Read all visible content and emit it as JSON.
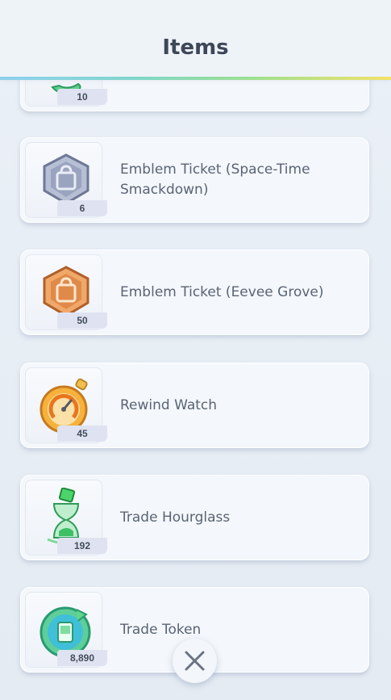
{
  "header": {
    "title": "Items"
  },
  "items": [
    {
      "name": "",
      "qty": "10",
      "icon": "green-item-icon"
    },
    {
      "name": "Emblem Ticket (Space-Time Smackdown)",
      "qty": "6",
      "icon": "silver-emblem-ticket-icon"
    },
    {
      "name": "Emblem Ticket (Eevee Grove)",
      "qty": "50",
      "icon": "bronze-emblem-ticket-icon"
    },
    {
      "name": "Rewind Watch",
      "qty": "45",
      "icon": "rewind-watch-icon"
    },
    {
      "name": "Trade Hourglass",
      "qty": "192",
      "icon": "trade-hourglass-icon"
    },
    {
      "name": "Trade Token",
      "qty": "8,890",
      "icon": "trade-token-icon"
    }
  ],
  "close": {
    "icon": "close-icon"
  }
}
